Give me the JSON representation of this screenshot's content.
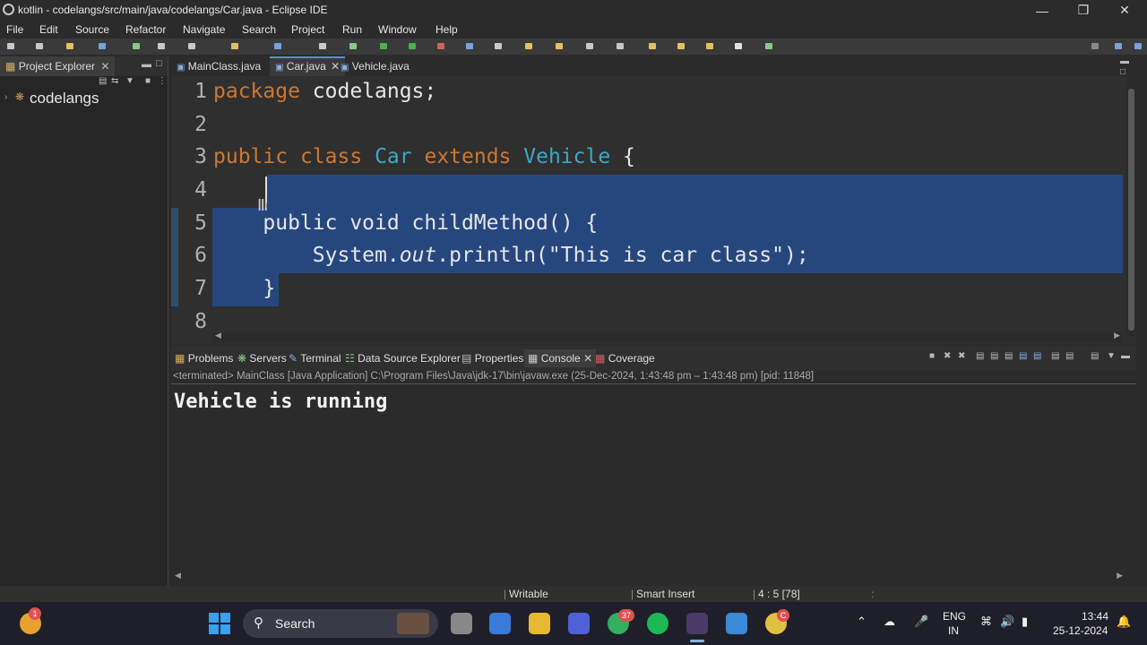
{
  "window": {
    "title": "kotlin - codelangs/src/main/java/codelangs/Car.java - Eclipse IDE"
  },
  "menu": [
    "File",
    "Edit",
    "Source",
    "Refactor",
    "Navigate",
    "Search",
    "Project",
    "Run",
    "Window",
    "Help"
  ],
  "project_explorer": {
    "tab_label": "Project Explorer",
    "items": [
      "codelangs"
    ]
  },
  "editor": {
    "tabs": [
      "MainClass.java",
      "Car.java",
      "Vehicle.java"
    ],
    "active_tab": "Car.java",
    "line_numbers": [
      "1",
      "2",
      "3",
      "4",
      "5",
      "6",
      "7",
      "8"
    ],
    "lines": {
      "l1_kw": "package",
      "l1_rest": " codelangs;",
      "l3_kw1": "public",
      "l3_kw2": "class",
      "l3_type1": "Car",
      "l3_kw3": "extends",
      "l3_type2": "Vehicle",
      "l3_brace": " {",
      "l5_code": "    public void childMethod() {",
      "l6_a": "        System.",
      "l6_b": "out",
      "l6_c": ".println(\"This is car class\");",
      "l7_code": "    }"
    },
    "colors": {
      "keyword": "#cc7832",
      "type": "#3fa7c4",
      "selection": "#26477e"
    }
  },
  "bottom_panel": {
    "tabs": [
      "Problems",
      "Servers",
      "Terminal",
      "Data Source Explorer",
      "Properties",
      "Console",
      "Coverage"
    ],
    "active_tab": "Console",
    "status_line": "<terminated> MainClass [Java Application] C:\\Program Files\\Java\\jdk-17\\bin\\javaw.exe  (25-Dec-2024, 1:43:48 pm – 1:43:48 pm) [pid: 11848]",
    "output": "Vehicle is running"
  },
  "statusbar": {
    "writable": "Writable",
    "insert_mode": "Smart Insert",
    "position": "4 : 5 [78]"
  },
  "taskbar": {
    "search_placeholder": "Search",
    "weather_badge": "1",
    "whatsapp_badge": "37",
    "chrome_badge": "C",
    "language": "ENG",
    "region": "IN",
    "time": "13:44",
    "date": "25-12-2024"
  }
}
